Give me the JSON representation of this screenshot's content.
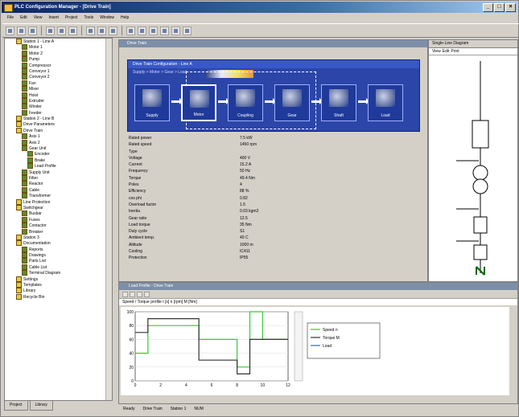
{
  "window": {
    "title": "PLC Configuration Manager - [Drive Train]"
  },
  "menu": [
    "File",
    "Edit",
    "View",
    "Insert",
    "Project",
    "Tools",
    "Window",
    "Help"
  ],
  "tree": {
    "items": [
      {
        "label": "Station 1 - Line A",
        "level": 2,
        "icon": "folder-icon"
      },
      {
        "label": "Motor 1",
        "level": 3,
        "icon": "node-icon"
      },
      {
        "label": "Motor 2",
        "level": 3,
        "icon": "node-icon"
      },
      {
        "label": "Pump",
        "level": 3,
        "icon": "node-icon"
      },
      {
        "label": "Compressor",
        "level": 3,
        "icon": "node-icon"
      },
      {
        "label": "Conveyor 1",
        "level": 3,
        "icon": "node-icon"
      },
      {
        "label": "Conveyor 2",
        "level": 3,
        "icon": "node-icon"
      },
      {
        "label": "Fan",
        "level": 3,
        "icon": "node-icon"
      },
      {
        "label": "Mixer",
        "level": 3,
        "icon": "node-icon"
      },
      {
        "label": "Hoist",
        "level": 3,
        "icon": "node-icon"
      },
      {
        "label": "Extruder",
        "level": 3,
        "icon": "node-icon"
      },
      {
        "label": "Winder",
        "level": 3,
        "icon": "node-icon"
      },
      {
        "label": "Feeder",
        "level": 3,
        "icon": "node-icon"
      },
      {
        "label": "Station 2 - Line B",
        "level": 2,
        "icon": "folder-icon"
      },
      {
        "label": "Drive Parameters",
        "level": 2,
        "icon": "folder-icon"
      },
      {
        "label": "Drive Train",
        "level": 2,
        "icon": "folder-icon"
      },
      {
        "label": "Axis 1",
        "level": 3,
        "icon": "node-icon"
      },
      {
        "label": "Axis 2",
        "level": 3,
        "icon": "node-icon"
      },
      {
        "label": "Gear Unit",
        "level": 3,
        "icon": "node-icon"
      },
      {
        "label": "Encoder",
        "level": 4,
        "icon": "node-icon"
      },
      {
        "label": "Brake",
        "level": 4,
        "icon": "node-icon"
      },
      {
        "label": "Load Profile",
        "level": 4,
        "icon": "node-icon"
      },
      {
        "label": "Supply Unit",
        "level": 3,
        "icon": "node-icon"
      },
      {
        "label": "Filter",
        "level": 3,
        "icon": "node-icon"
      },
      {
        "label": "Reactor",
        "level": 3,
        "icon": "node-icon"
      },
      {
        "label": "Cable",
        "level": 3,
        "icon": "node-icon"
      },
      {
        "label": "Transformer",
        "level": 3,
        "icon": "node-icon"
      },
      {
        "label": "Line Protection",
        "level": 2,
        "icon": "folder-icon"
      },
      {
        "label": "Switchgear",
        "level": 2,
        "icon": "folder-icon"
      },
      {
        "label": "Busbar",
        "level": 3,
        "icon": "node-icon"
      },
      {
        "label": "Fuses",
        "level": 3,
        "icon": "node-icon"
      },
      {
        "label": "Contactor",
        "level": 3,
        "icon": "node-icon"
      },
      {
        "label": "Breaker",
        "level": 3,
        "icon": "node-icon"
      },
      {
        "label": "Station 3",
        "level": 2,
        "icon": "folder-icon"
      },
      {
        "label": "Documentation",
        "level": 2,
        "icon": "folder-icon"
      },
      {
        "label": "Reports",
        "level": 3,
        "icon": "node-icon"
      },
      {
        "label": "Drawings",
        "level": 3,
        "icon": "node-icon"
      },
      {
        "label": "Parts List",
        "level": 3,
        "icon": "node-icon"
      },
      {
        "label": "Cable List",
        "level": 3,
        "icon": "node-icon"
      },
      {
        "label": "Terminal Diagram",
        "level": 3,
        "icon": "node-icon"
      },
      {
        "label": "Settings",
        "level": 2,
        "icon": "folder-icon"
      },
      {
        "label": "Templates",
        "level": 2,
        "icon": "folder-icon"
      },
      {
        "label": "Library",
        "level": 2,
        "icon": "folder-icon"
      },
      {
        "label": "Recycle Bin",
        "level": 2,
        "icon": "folder-icon"
      }
    ],
    "tabs": [
      "Project",
      "Library"
    ]
  },
  "doc": {
    "title": "Drive Train",
    "panel_title": "Drive Train Configuration - Line A",
    "panel_sub": "Supply  >  Motor  >  Gear  >  Load",
    "flow": [
      {
        "label": "Supply",
        "selected": false
      },
      {
        "label": "Motor",
        "selected": true
      },
      {
        "label": "Coupling",
        "selected": false
      },
      {
        "label": "Gear",
        "selected": false
      },
      {
        "label": "Shaft",
        "selected": false
      },
      {
        "label": "Load",
        "selected": false
      }
    ],
    "params": [
      {
        "k": "Rated power",
        "v": "7.5 kW",
        "u": ""
      },
      {
        "k": "Rated speed",
        "v": "1450 rpm",
        "u": ""
      },
      {
        "k": "Type",
        "v": "",
        "u": ""
      },
      {
        "k": "Voltage",
        "v": "400 V",
        "u": ""
      },
      {
        "k": "Current",
        "v": "15.2 A",
        "u": ""
      },
      {
        "k": "Frequency",
        "v": "50 Hz",
        "u": ""
      },
      {
        "k": "Torque",
        "v": "49.4 Nm",
        "u": ""
      },
      {
        "k": "Poles",
        "v": "4",
        "u": ""
      },
      {
        "k": "Efficiency",
        "v": "88 %",
        "u": ""
      },
      {
        "k": "cos phi",
        "v": "0.82",
        "u": ""
      },
      {
        "k": "Overload factor",
        "v": "1.5",
        "u": ""
      },
      {
        "k": "Inertia",
        "v": "0.03 kgm2",
        "u": ""
      },
      {
        "k": "Gear ratio",
        "v": "12.5",
        "u": ""
      },
      {
        "k": "Load torque",
        "v": "35 Nm",
        "u": ""
      },
      {
        "k": "Duty cycle",
        "v": "S1",
        "u": ""
      },
      {
        "k": "Ambient temp.",
        "v": "40 C",
        "u": ""
      },
      {
        "k": "Altitude",
        "v": "1000 m",
        "u": ""
      },
      {
        "k": "Cooling",
        "v": "IC411",
        "u": ""
      },
      {
        "k": "Protection",
        "v": "IP55",
        "u": ""
      }
    ]
  },
  "rpanel": {
    "title": "Single-Line Diagram",
    "tabs": [
      "View",
      "Edit",
      "Print"
    ]
  },
  "bottom": {
    "title": "Load Profile - Drive Train",
    "header": "Speed / Torque profile  t [s]  n [rpm]  M [Nm]",
    "legend": [
      "Speed n",
      "Torque M",
      "Load"
    ],
    "xticks": [
      "0",
      "2",
      "4",
      "6",
      "8",
      "10",
      "12"
    ],
    "yticks": [
      "0",
      "20",
      "40",
      "60",
      "80",
      "100"
    ]
  },
  "chart_data": {
    "type": "line",
    "title": "",
    "xlabel": "",
    "ylabel": "",
    "x": [
      0,
      1,
      1,
      2,
      2,
      5,
      5,
      8,
      8,
      9,
      9,
      10,
      10,
      12
    ],
    "series": [
      {
        "name": "Speed n",
        "color": "#33cc33",
        "values": [
          40,
          40,
          80,
          80,
          80,
          80,
          60,
          60,
          20,
          20,
          100,
          100,
          60,
          60
        ]
      },
      {
        "name": "Torque M",
        "color": "#333333",
        "values": [
          70,
          70,
          90,
          90,
          90,
          90,
          30,
          30,
          10,
          10,
          60,
          60,
          60,
          60
        ]
      }
    ],
    "ylim": [
      0,
      100
    ],
    "xlim": [
      0,
      12
    ]
  },
  "status": [
    "Ready",
    "Drive Train",
    "Station 1",
    "NUM"
  ]
}
